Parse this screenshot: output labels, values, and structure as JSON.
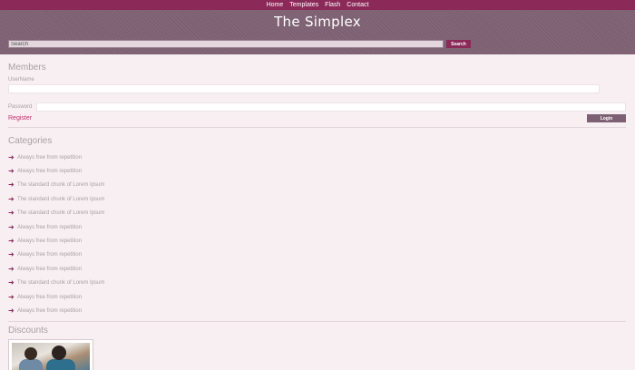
{
  "nav": {
    "items": [
      {
        "label": "Home"
      },
      {
        "label": "Templates"
      },
      {
        "label": "Flash"
      },
      {
        "label": "Contact"
      }
    ]
  },
  "header": {
    "title": "The Simplex"
  },
  "search": {
    "value": "Search",
    "button_label": "Search"
  },
  "members": {
    "heading": "Members",
    "username_label": "UserName",
    "password_label": "Password",
    "register_label": "Register",
    "login_label": "Login"
  },
  "categories": {
    "heading": "Categories",
    "items": [
      {
        "label": "Always free from repetition"
      },
      {
        "label": "Always free from repetition"
      },
      {
        "label": "The standard chunk of Lorem Ipsum"
      },
      {
        "label": "The standard chunk of Lorem Ipsum"
      },
      {
        "label": "The standard chunk of Lorem Ipsum"
      },
      {
        "label": "Always free from repetition"
      },
      {
        "label": "Always free from repetition"
      },
      {
        "label": "Always free from repetition"
      },
      {
        "label": "Always free from repetition"
      },
      {
        "label": "The standard chunk of Lorem Ipsum"
      },
      {
        "label": "Always free from repetition"
      },
      {
        "label": "Always free from repetition"
      }
    ]
  },
  "discounts": {
    "heading": "Discounts"
  },
  "colors": {
    "accent": "#8b2a58",
    "header_bg": "#7d6173",
    "page_bg": "#f7eff2",
    "link": "#c0306c"
  },
  "icons": {
    "category_bullet": "arrow-right-icon"
  }
}
